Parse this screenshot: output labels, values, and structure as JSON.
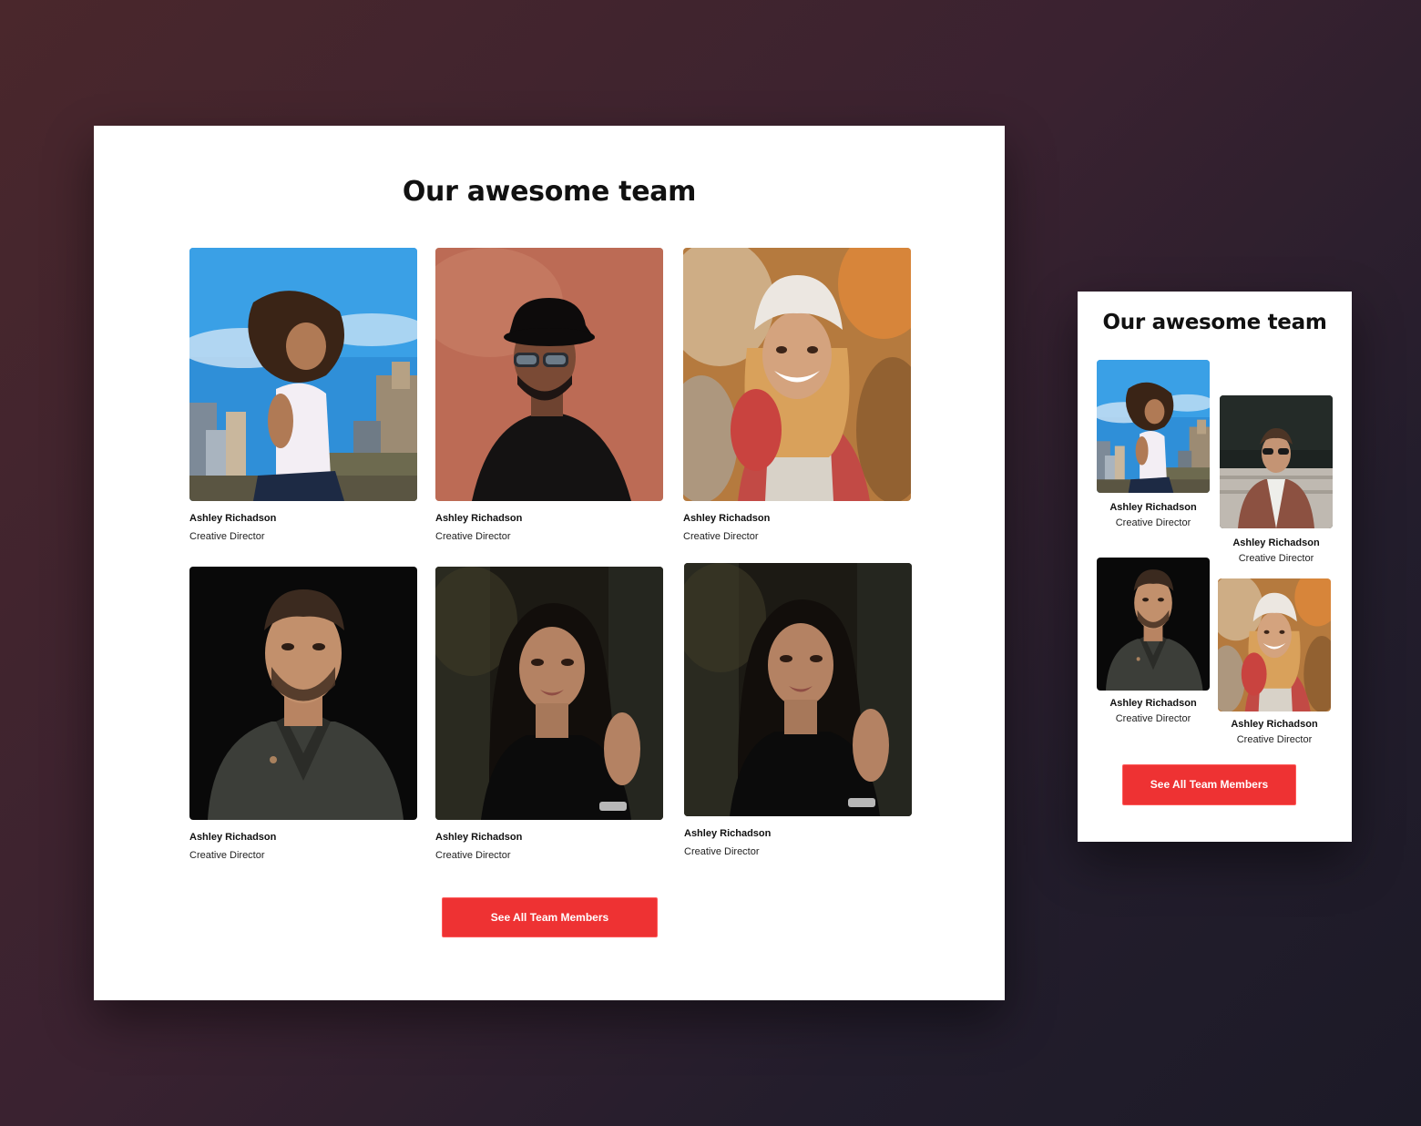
{
  "desktop": {
    "title": "Our awesome team",
    "members": [
      {
        "name": "Ashley Richadson",
        "role": "Creative Director",
        "photo": "woman-city-photo"
      },
      {
        "name": "Ashley Richadson",
        "role": "Creative Director",
        "photo": "man-hat-photo"
      },
      {
        "name": "Ashley Richadson",
        "role": "Creative Director",
        "photo": "woman-beanie-photo"
      },
      {
        "name": "Ashley Richadson",
        "role": "Creative Director",
        "photo": "man-sweater-photo"
      },
      {
        "name": "Ashley Richadson",
        "role": "Creative Director",
        "photo": "woman-dark-hair-photo"
      },
      {
        "name": "Ashley Richadson",
        "role": "Creative Director",
        "photo": "woman-dark-hair-photo"
      }
    ],
    "cta_label": "See All Team Members"
  },
  "mobile": {
    "title": "Our awesome team",
    "members": [
      {
        "name": "Ashley Richadson",
        "role": "Creative Director",
        "photo": "woman-city-photo"
      },
      {
        "name": "Ashley Richadson",
        "role": "Creative Director",
        "photo": "man-sunglasses-photo"
      },
      {
        "name": "Ashley Richadson",
        "role": "Creative Director",
        "photo": "man-sweater-photo"
      },
      {
        "name": "Ashley Richadson",
        "role": "Creative Director",
        "photo": "woman-beanie-photo"
      }
    ],
    "cta_label": "See All Team Members"
  },
  "colors": {
    "accent": "#ee3233",
    "background_start": "#4a272c",
    "background_end": "#1c1a27",
    "card": "#ffffff",
    "text": "#111111"
  }
}
